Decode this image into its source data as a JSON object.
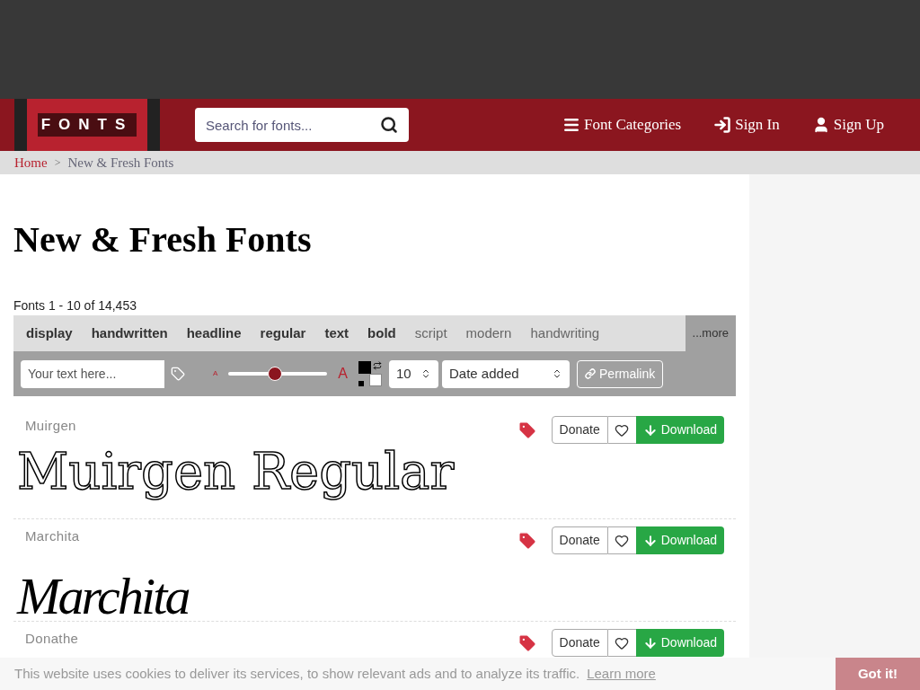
{
  "header": {
    "logo": {
      "text": "FONTS"
    },
    "search": {
      "placeholder": "Search for fonts..."
    },
    "nav": [
      {
        "label": "Font Categories",
        "kind": "menu"
      },
      {
        "label": "Sign In",
        "kind": "signin"
      },
      {
        "label": "Sign Up",
        "kind": "user"
      }
    ]
  },
  "breadcrumb": [
    {
      "label": "Home",
      "kind": "link"
    },
    {
      "label": ">",
      "kind": "sep"
    },
    {
      "label": "New & Fresh Fonts",
      "kind": "current"
    }
  ],
  "title": "New & Fresh Fonts",
  "count": "Fonts 1 - 10 of 14,453",
  "tags": [
    {
      "label": "display",
      "bold": true
    },
    {
      "label": "handwritten",
      "bold": true
    },
    {
      "label": "headline",
      "bold": true
    },
    {
      "label": "regular",
      "bold": true
    },
    {
      "label": "text",
      "bold": true
    },
    {
      "label": "bold",
      "bold": true
    },
    {
      "label": "script",
      "bold": false
    },
    {
      "label": "modern",
      "bold": false
    },
    {
      "label": "handwriting",
      "bold": false
    }
  ],
  "more": "...more",
  "toolbar": {
    "text_field": {
      "placeholder": "Your text here..."
    },
    "size_small": "A",
    "size_large": "A",
    "size": {
      "level": 0.47
    },
    "per_page": "10",
    "sort": "Date added",
    "permalink": "Permalink"
  },
  "fonts": [
    {
      "name": "Muirgen",
      "preview": "Muirgen Regular",
      "kind": "outline",
      "donate": "Donate",
      "download": "Download"
    },
    {
      "name": "Marchita",
      "preview": "Marchita",
      "kind": "script",
      "donate": "Donate",
      "download": "Download"
    },
    {
      "name": "Donathe",
      "kind": "cut",
      "donate": "Donate",
      "download": "Download"
    }
  ],
  "cookie": {
    "text": "This website uses cookies to deliver its services, to show relevant ads and to analyze its traffic.",
    "link": "Learn more",
    "button": "Got it!"
  }
}
